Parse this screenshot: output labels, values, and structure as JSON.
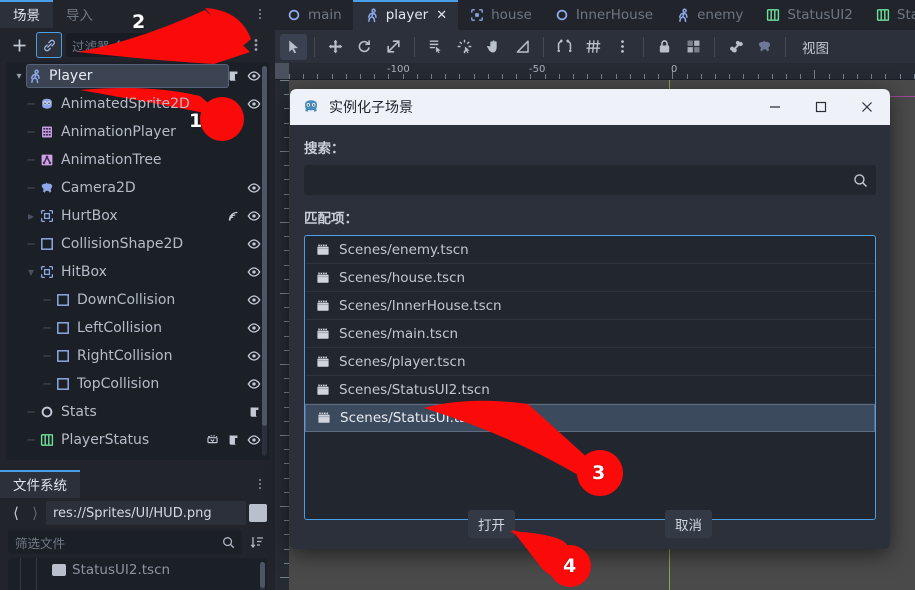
{
  "app": {
    "theme_bg": "#21252b",
    "accent": "#4b9fe8"
  },
  "left_dock": {
    "tabs": [
      {
        "label": "场景",
        "name": "scene",
        "active": true
      },
      {
        "label": "导入",
        "name": "import",
        "active": false
      }
    ],
    "menu_icon": "kebab-menu-icon",
    "toolbar": {
      "add_label": "+",
      "add_icon": "plus-icon",
      "link_icon": "link-icon",
      "filter_placeholder": "过滤器:名称、t:",
      "search_icon": "search-icon",
      "attach_script_icon": "detach-script-icon",
      "more_icon": "kebab-menu-icon"
    },
    "tree": [
      {
        "label": "Player",
        "icon": "character-body-2d-icon",
        "depth": 0,
        "twisty": "down",
        "selected": true,
        "eye": true,
        "script": true,
        "signal": false,
        "anim": false
      },
      {
        "label": "AnimatedSprite2D",
        "icon": "animated-sprite-2d-icon",
        "depth": 1,
        "twisty": "none",
        "selected": false,
        "eye": true,
        "script": false,
        "signal": false,
        "anim": false
      },
      {
        "label": "AnimationPlayer",
        "icon": "animation-player-icon",
        "depth": 1,
        "twisty": "none",
        "selected": false,
        "eye": false,
        "script": false,
        "signal": false,
        "anim": false
      },
      {
        "label": "AnimationTree",
        "icon": "animation-tree-icon",
        "depth": 1,
        "twisty": "none",
        "selected": false,
        "eye": false,
        "script": false,
        "signal": false,
        "anim": false
      },
      {
        "label": "Camera2D",
        "icon": "camera-2d-icon",
        "depth": 1,
        "twisty": "none",
        "selected": false,
        "eye": true,
        "script": false,
        "signal": false,
        "anim": false
      },
      {
        "label": "HurtBox",
        "icon": "area-2d-icon",
        "depth": 1,
        "twisty": "right",
        "selected": false,
        "eye": true,
        "script": false,
        "signal": true,
        "anim": false
      },
      {
        "label": "CollisionShape2D",
        "icon": "collision-shape-2d-icon",
        "depth": 1,
        "twisty": "none",
        "selected": false,
        "eye": true,
        "script": false,
        "signal": false,
        "anim": false
      },
      {
        "label": "HitBox",
        "icon": "area-2d-icon",
        "depth": 1,
        "twisty": "down",
        "selected": false,
        "eye": true,
        "script": false,
        "signal": false,
        "anim": false
      },
      {
        "label": "DownCollision",
        "icon": "collision-shape-2d-icon",
        "depth": 2,
        "twisty": "none",
        "selected": false,
        "eye": true,
        "script": false,
        "signal": false,
        "anim": false
      },
      {
        "label": "LeftCollision",
        "icon": "collision-shape-2d-icon",
        "depth": 2,
        "twisty": "none",
        "selected": false,
        "eye": true,
        "script": false,
        "signal": false,
        "anim": false
      },
      {
        "label": "RightCollision",
        "icon": "collision-shape-2d-icon",
        "depth": 2,
        "twisty": "none",
        "selected": false,
        "eye": true,
        "script": false,
        "signal": false,
        "anim": false
      },
      {
        "label": "TopCollision",
        "icon": "collision-shape-2d-icon",
        "depth": 2,
        "twisty": "none",
        "selected": false,
        "eye": true,
        "script": false,
        "signal": false,
        "anim": false
      },
      {
        "label": "Stats",
        "icon": "node-icon",
        "depth": 1,
        "twisty": "none",
        "selected": false,
        "eye": false,
        "script": true,
        "signal": false,
        "anim": false
      },
      {
        "label": "PlayerStatus",
        "icon": "control-ui-icon",
        "depth": 1,
        "twisty": "none",
        "selected": false,
        "eye": true,
        "script": true,
        "signal": false,
        "anim": true
      }
    ]
  },
  "filesystem_dock": {
    "tab_label": "文件系统",
    "menu_icon": "kebab-menu-icon",
    "back_icon": "chevron-left-icon",
    "forward_icon": "chevron-right-icon",
    "path_value": "res://Sprites/UI/HUD.png",
    "favorite_icon": "favorite-square-icon",
    "filter_placeholder": "筛选文件",
    "search_icon": "search-icon",
    "sort_icon": "sort-icon",
    "items": [
      {
        "label": "StatusUI2.tscn",
        "icon": "file-icon"
      }
    ]
  },
  "scene_tabs": [
    {
      "label": "main",
      "icon": "node-icon",
      "active": false,
      "closable": false
    },
    {
      "label": "player",
      "icon": "character-body-2d-icon",
      "active": true,
      "closable": true,
      "close_icon": "close-icon"
    },
    {
      "label": "house",
      "icon": "tilemap-icon",
      "active": false,
      "closable": false
    },
    {
      "label": "InnerHouse",
      "icon": "node-icon",
      "active": false,
      "closable": false
    },
    {
      "label": "enemy",
      "icon": "character-body-2d-icon",
      "active": false,
      "closable": false
    },
    {
      "label": "StatusUI2",
      "icon": "control-ui-icon",
      "active": false,
      "closable": false
    },
    {
      "label": "Stat",
      "icon": "control-ui-icon",
      "active": false,
      "closable": false
    }
  ],
  "canvas_toolbar": {
    "buttons": [
      {
        "name": "select-mode-button",
        "icon": "cursor-arrow-icon",
        "active": true
      },
      {
        "name": "move-mode-button",
        "icon": "move-icon",
        "active": false
      },
      {
        "name": "rotate-mode-button",
        "icon": "rotate-icon",
        "active": false
      },
      {
        "name": "scale-mode-button",
        "icon": "scale-icon",
        "active": false
      },
      {
        "name": "list-select-button",
        "icon": "list-select-icon",
        "active": false
      },
      {
        "name": "pivot-mode-button",
        "icon": "pivot-icon",
        "active": false
      },
      {
        "name": "pan-mode-button",
        "icon": "hand-icon",
        "active": false
      },
      {
        "name": "ruler-mode-button",
        "icon": "ruler-icon",
        "active": false
      },
      {
        "name": "snap-mode-button",
        "icon": "magnet-icon",
        "active": false
      },
      {
        "name": "grid-snap-button",
        "icon": "grid-icon",
        "active": false
      },
      {
        "name": "snap-options-button",
        "icon": "kebab-menu-icon",
        "active": false
      },
      {
        "name": "lock-button",
        "icon": "lock-icon",
        "active": false
      },
      {
        "name": "group-button",
        "icon": "group-icon",
        "active": false
      },
      {
        "name": "skeleton-button",
        "icon": "bone-icon",
        "active": false
      },
      {
        "name": "camera-override-button",
        "icon": "camera-2d-icon",
        "active": false
      }
    ],
    "view_menu_label": "视图"
  },
  "ruler": {
    "labels": [
      "-100",
      "-50",
      "0"
    ],
    "label_positions": [
      110,
      252,
      394
    ]
  },
  "dialog": {
    "icon": "godot-logo-icon",
    "title": "实例化子场景",
    "window_buttons": {
      "minimize_icon": "minimize-icon",
      "maximize_icon": "maximize-icon",
      "close_icon": "close-icon"
    },
    "search_label": "搜索：",
    "search_value": "",
    "search_icon": "search-icon",
    "matches_label": "匹配项：",
    "items": [
      {
        "label": "Scenes/enemy.tscn",
        "icon": "scene-file-icon",
        "selected": false
      },
      {
        "label": "Scenes/house.tscn",
        "icon": "scene-file-icon",
        "selected": false
      },
      {
        "label": "Scenes/InnerHouse.tscn",
        "icon": "scene-file-icon",
        "selected": false
      },
      {
        "label": "Scenes/main.tscn",
        "icon": "scene-file-icon",
        "selected": false
      },
      {
        "label": "Scenes/player.tscn",
        "icon": "scene-file-icon",
        "selected": false
      },
      {
        "label": "Scenes/StatusUI2.tscn",
        "icon": "scene-file-icon",
        "selected": false
      },
      {
        "label": "Scenes/StatusUI.tscn",
        "icon": "scene-file-icon",
        "selected": true
      }
    ],
    "open_label": "打开",
    "cancel_label": "取消"
  },
  "annotations": [
    {
      "number": "1",
      "color": "#fb0a0a"
    },
    {
      "number": "2",
      "color": "#fb0a0a"
    },
    {
      "number": "3",
      "color": "#fb0a0a"
    },
    {
      "number": "4",
      "color": "#fb0a0a"
    }
  ]
}
